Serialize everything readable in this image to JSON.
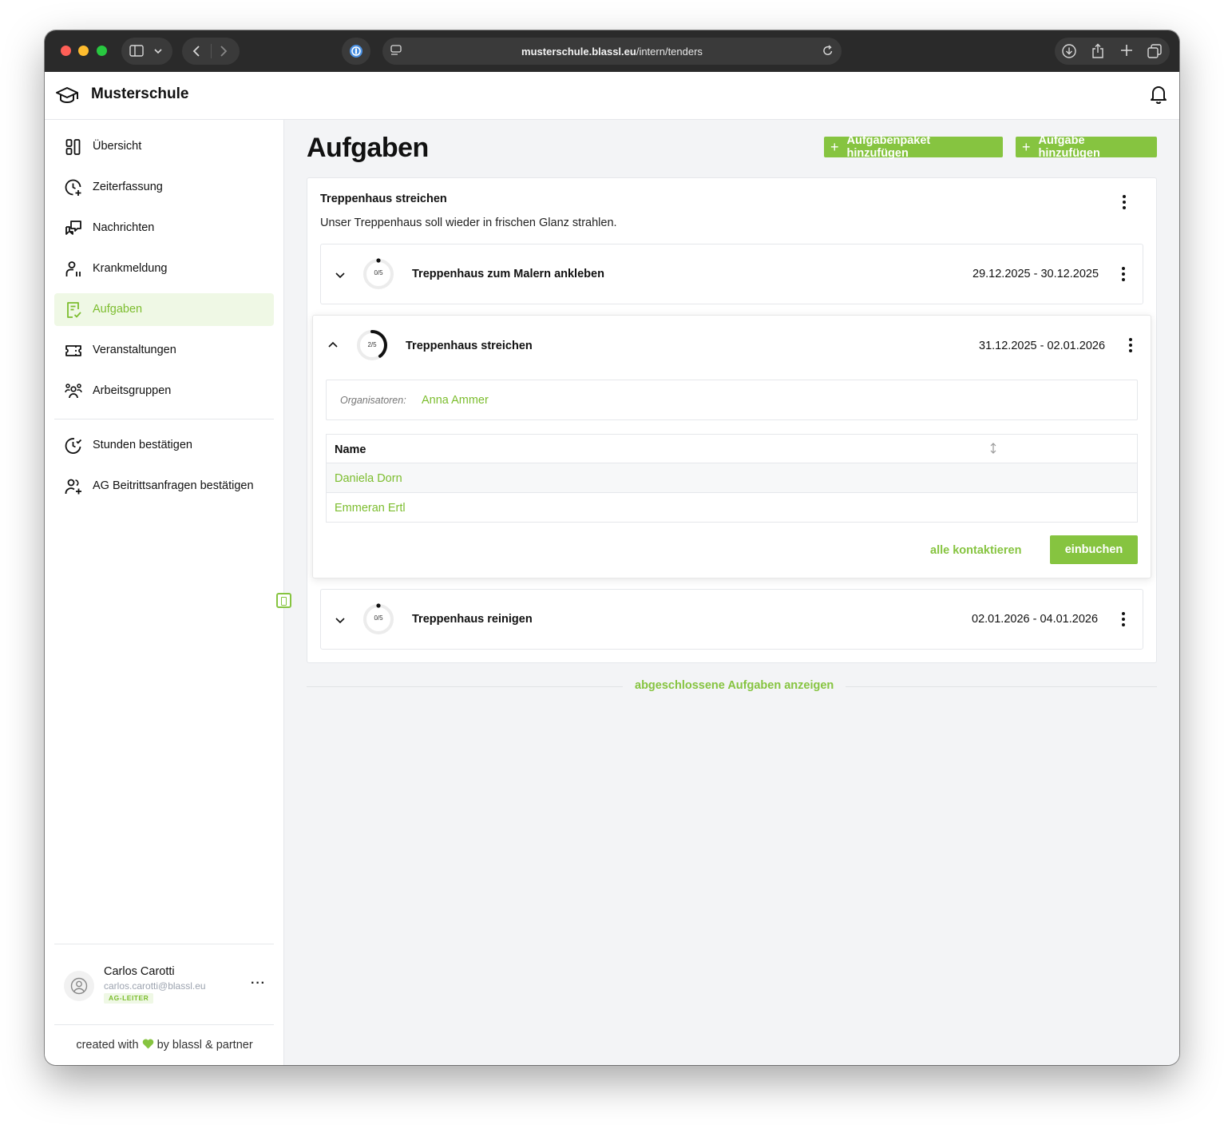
{
  "browser": {
    "url_host": "musterschule.blassl.eu",
    "url_path": "/intern/tenders"
  },
  "app": {
    "brand": "Musterschule"
  },
  "sidebar": {
    "items": [
      {
        "label": "Übersicht",
        "icon": "dashboard-icon"
      },
      {
        "label": "Zeiterfassung",
        "icon": "clock-plus-icon"
      },
      {
        "label": "Nachrichten",
        "icon": "chat-bubbles-icon"
      },
      {
        "label": "Krankmeldung",
        "icon": "person-sick-icon"
      },
      {
        "label": "Aufgaben",
        "icon": "task-list-icon",
        "active": true
      },
      {
        "label": "Veranstaltungen",
        "icon": "ticket-icon"
      },
      {
        "label": "Arbeitsgruppen",
        "icon": "group-icon"
      }
    ],
    "admin_items": [
      {
        "label": "Stunden bestätigen",
        "icon": "clock-check-icon"
      },
      {
        "label": "AG Beitrittsanfragen bestätigen",
        "icon": "user-add-icon"
      }
    ],
    "user": {
      "name": "Carlos Carotti",
      "email": "carlos.carotti@blassl.eu",
      "role": "AG-LEITER"
    },
    "footer": {
      "prefix": "created with",
      "suffix": "by blassl & partner"
    }
  },
  "main": {
    "title": "Aufgaben",
    "add_package_label": "Aufgabenpaket hinzufügen",
    "add_task_label": "Aufgabe hinzufügen",
    "package": {
      "title": "Treppenhaus streichen",
      "description": "Unser Treppenhaus soll wieder in frischen Glanz strahlen.",
      "tasks": [
        {
          "name": "Treppenhaus zum Malern ankleben",
          "progress": "0/5",
          "progress_fraction": 0.0,
          "dates": "29.12.2025 - 30.12.2025",
          "expanded": false
        },
        {
          "name": "Treppenhaus streichen",
          "progress": "2/5",
          "progress_fraction": 0.4,
          "dates": "31.12.2025 - 02.01.2026",
          "expanded": true,
          "organizers_label": "Organisatoren:",
          "organizers": "Anna Ammer",
          "table_header": "Name",
          "participants": [
            "Daniela Dorn",
            "Emmeran Ertl"
          ],
          "contact_all_label": "alle kontaktieren",
          "book_label": "einbuchen"
        },
        {
          "name": "Treppenhaus reinigen",
          "progress": "0/5",
          "progress_fraction": 0.0,
          "dates": "02.01.2026 - 04.01.2026",
          "expanded": false
        }
      ]
    },
    "show_completed_label": "abgeschlossene Aufgaben anzeigen"
  },
  "colors": {
    "accent": "#86c440",
    "accent_text": "#7cbd2e",
    "active_bg": "#eff8e5",
    "main_bg": "#f3f4f6"
  }
}
